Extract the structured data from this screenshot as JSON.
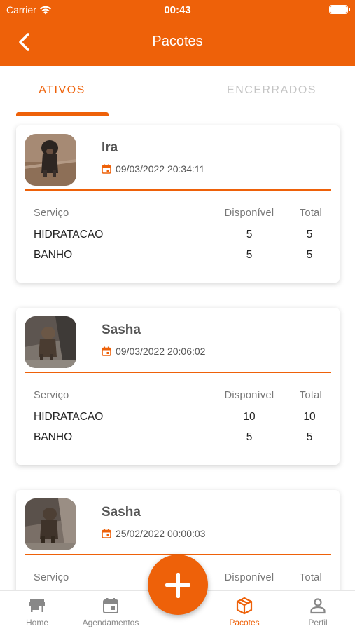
{
  "status_bar": {
    "carrier": "Carrier",
    "time": "00:43"
  },
  "header": {
    "title": "Pacotes"
  },
  "tabs": [
    {
      "label": "ATIVOS",
      "active": true
    },
    {
      "label": "ENCERRADOS",
      "active": false
    }
  ],
  "table_headers": {
    "service": "Serviço",
    "available": "Disponível",
    "total": "Total"
  },
  "cards": [
    {
      "pet_name": "Ira",
      "date": "09/03/2022 20:34:11",
      "services": [
        {
          "name": "HIDRATACAO",
          "available": "5",
          "total": "5"
        },
        {
          "name": "BANHO",
          "available": "5",
          "total": "5"
        }
      ]
    },
    {
      "pet_name": "Sasha",
      "date": "09/03/2022 20:06:02",
      "services": [
        {
          "name": "HIDRATACAO",
          "available": "10",
          "total": "10"
        },
        {
          "name": "BANHO",
          "available": "5",
          "total": "5"
        }
      ]
    },
    {
      "pet_name": "Sasha",
      "date": "25/02/2022 00:00:03",
      "services": []
    }
  ],
  "bottom_nav": [
    {
      "label": "Home",
      "icon": "store-icon"
    },
    {
      "label": "Agendamentos",
      "icon": "calendar-icon"
    },
    {
      "label": "Pacotes",
      "icon": "package-icon",
      "active": true
    },
    {
      "label": "Perfil",
      "icon": "person-icon"
    }
  ],
  "colors": {
    "accent": "#ee6109",
    "inactive_tab": "#c4c4c4",
    "nav_inactive": "#888888"
  }
}
